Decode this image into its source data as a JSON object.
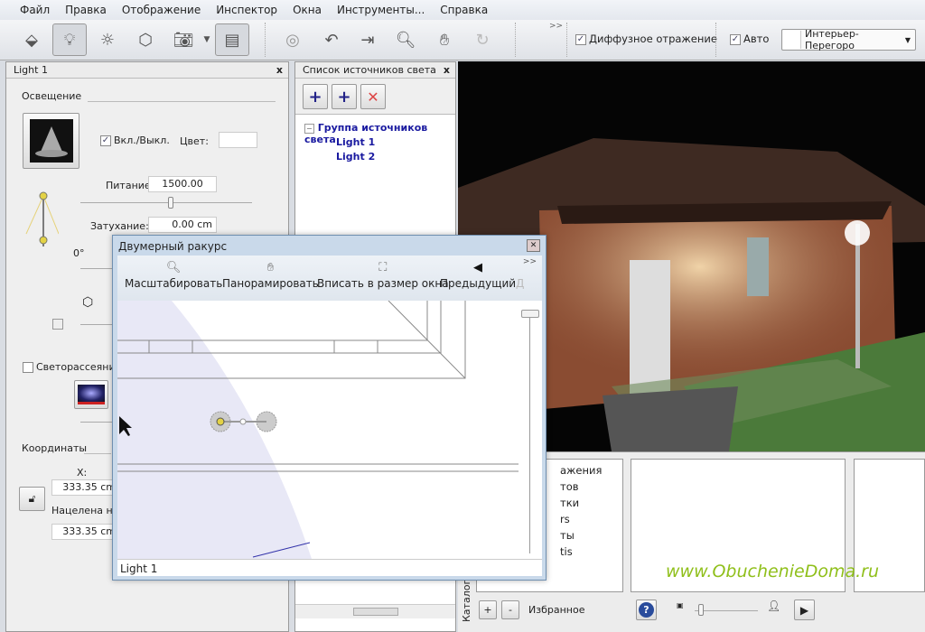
{
  "menu": [
    "Файл",
    "Правка",
    "Отображение",
    "Инспектор",
    "Окна",
    "Инструменты...",
    "Справка"
  ],
  "toolbar": {
    "diffuse_label": "Диффузное отражение",
    "diffuse_checked": true,
    "auto_label": "Авто",
    "auto_checked": true,
    "material_select": "Интерьер- Перегоро",
    "overflow": ">>"
  },
  "light_panel": {
    "title": "Light 1",
    "close": "x",
    "section_lighting": "Освещение",
    "onoff_label": "Вкл./Выкл.",
    "onoff_checked": true,
    "color_label": "Цвет:",
    "power_label": "Питание:",
    "power_value": "1500.00",
    "attenuation_label": "Затухание:",
    "attenuation_value": "0.00 cm",
    "angle_label": "0°",
    "diffusion_label": "Светорассеяние",
    "diffusion_checked": false,
    "coords_section": "Координаты",
    "x_label": "X:",
    "x_value": "333.35 cm",
    "target_label": "Нацелена на:",
    "target_value": "333.35 cm"
  },
  "light_list": {
    "title": "Список источников света",
    "close": "x",
    "group": "Группа источников света",
    "items": [
      "Light 1",
      "Light 2"
    ]
  },
  "dialog": {
    "title": "Двумерный ракурс",
    "tools": [
      "Масштабировать",
      "Панорамировать",
      "Вписать в размер окна",
      "Предыдущий",
      "Д"
    ],
    "overflow": ">>",
    "status": "Light 1"
  },
  "catalog": {
    "tab": "Каталог",
    "items": [
      "ажения",
      "тов",
      "тки",
      "rs",
      "ты",
      "tis"
    ],
    "plus": "+",
    "minus": "-",
    "favorites": "Избранное",
    "help": "?"
  },
  "watermark": "www.ObuchenieDoma.ru"
}
